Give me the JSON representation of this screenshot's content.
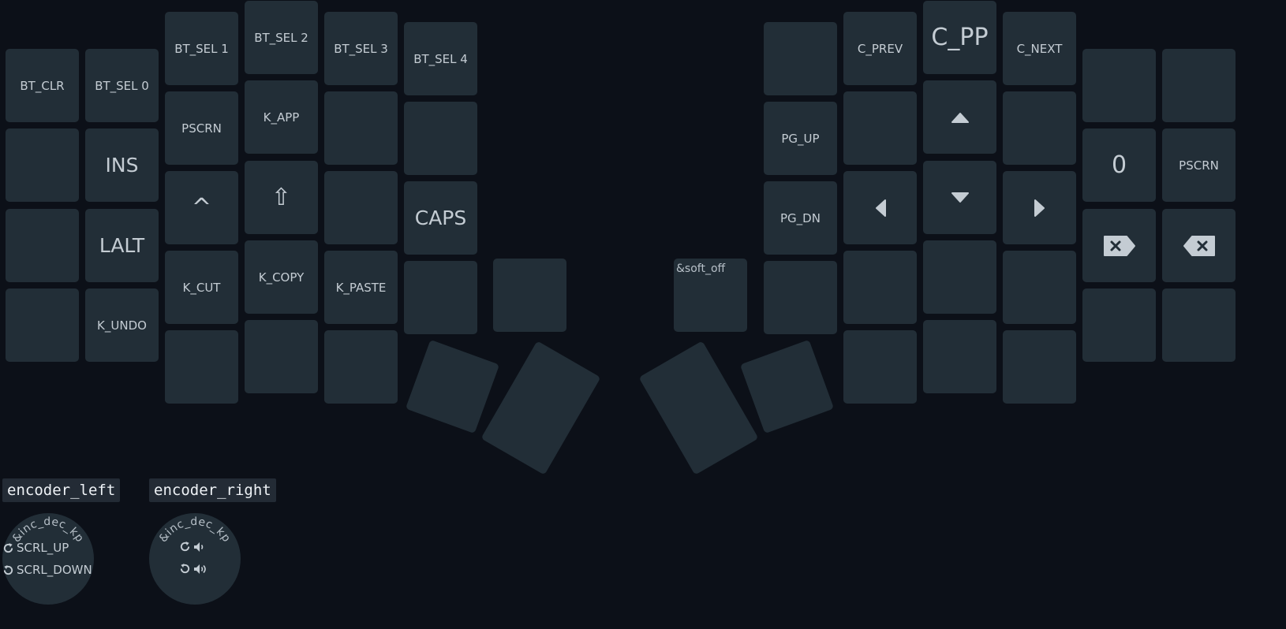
{
  "colors": {
    "background": "#0c1018",
    "key": "#222e37",
    "key_text": "#c4ccd3",
    "label_bg": "#232b35"
  },
  "left_keys": {
    "bt_clr": "BT_CLR",
    "bt_sel_0": "BT_SEL 0",
    "bt_sel_1": "BT_SEL 1",
    "bt_sel_2": "BT_SEL 2",
    "bt_sel_3": "BT_SEL 3",
    "bt_sel_4": "BT_SEL 4",
    "ins": "INS",
    "pscrn": "PSCRN",
    "k_app": "K_APP",
    "lalt": "LALT",
    "ctrl": "^",
    "shift": "⇧",
    "caps": "CAPS",
    "k_undo": "K_UNDO",
    "k_cut": "K_CUT",
    "k_copy": "K_COPY",
    "k_paste": "K_PASTE"
  },
  "right_keys": {
    "c_prev": "C_PREV",
    "c_pp": "C_PP",
    "c_next": "C_NEXT",
    "pg_up": "PG_UP",
    "pg_dn": "PG_DN",
    "zero": "0",
    "pscrn": "PSCRN",
    "soft_off": "&soft_off",
    "up_icon": "triangle-up-icon",
    "down_icon": "triangle-down-icon",
    "left_icon": "triangle-left-icon",
    "right_icon": "triangle-right-icon",
    "backspace_icon": "backspace-icon",
    "delete_icon": "delete-icon"
  },
  "encoders": [
    {
      "name": "encoder_left",
      "binding": "&inc_dec_kp",
      "cw": "SCRL_UP",
      "ccw": "SCRL_DOWN"
    },
    {
      "name": "encoder_right",
      "binding": "&inc_dec_kp",
      "cw_icon": "volume-down-icon",
      "ccw_icon": "volume-up-icon"
    }
  ],
  "icons": {
    "rotate_cw": "rotate-cw-icon",
    "rotate_ccw": "rotate-ccw-icon"
  }
}
